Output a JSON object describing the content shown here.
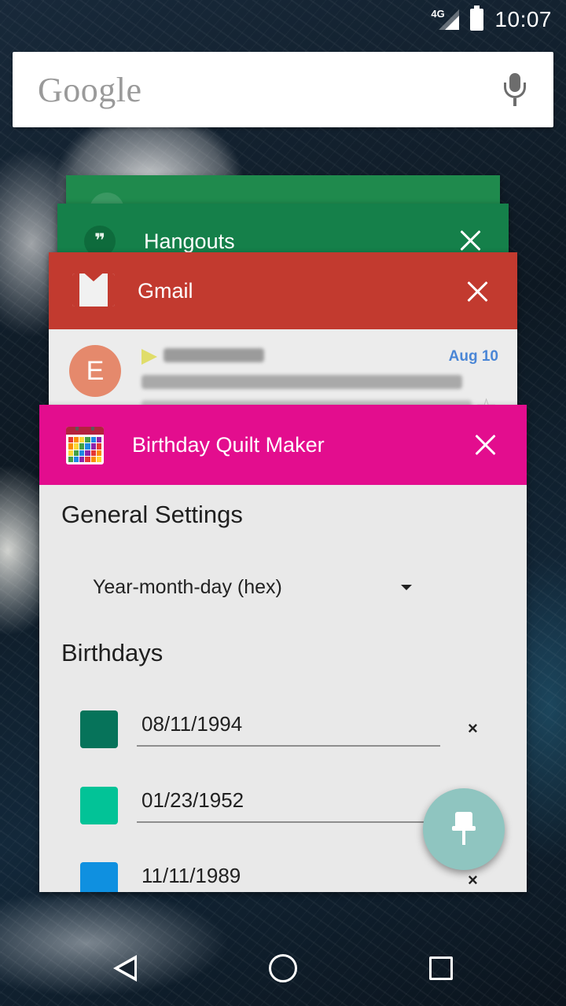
{
  "status_bar": {
    "network": "4G",
    "time": "10:07"
  },
  "search": {
    "logo": "Google"
  },
  "recents": {
    "hangouts": {
      "title": "Hangouts",
      "icon": "quote-bubble-icon",
      "color": "#15804a"
    },
    "gmail": {
      "title": "Gmail",
      "color": "#c23a2f",
      "preview": {
        "avatar_letter": "E",
        "date": "Aug 10"
      }
    },
    "quilt": {
      "title": "Birthday Quilt Maker",
      "color": "#e30d8e",
      "general_heading": "General Settings",
      "format_value": "Year-month-day (hex)",
      "birthdays_heading": "Birthdays",
      "birthdays": [
        {
          "date": "08/11/1994",
          "color": "#06735a"
        },
        {
          "date": "01/23/1952",
          "color": "#02c397"
        },
        {
          "date": "11/11/1989",
          "color": "#0f90e0"
        }
      ],
      "remove_symbol": "×"
    }
  },
  "fab": {
    "icon": "pin-icon",
    "color": "#8fc5c0"
  },
  "nav": {
    "back": "back-icon",
    "home": "home-icon",
    "recents": "recents-icon"
  }
}
